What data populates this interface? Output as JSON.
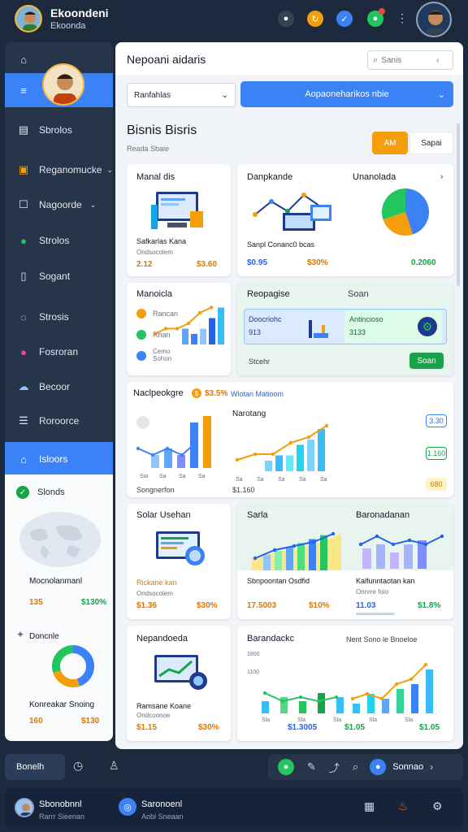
{
  "app": {
    "title": "Ekoondeni",
    "subtitle": "Ekoonda"
  },
  "colors": {
    "bg": "#1d2a3d",
    "accent": "#3b82f6",
    "orange": "#f59e0b",
    "green": "#16a34a"
  },
  "sidebar": {
    "items": [
      {
        "label": "",
        "icon": "home-icon"
      },
      {
        "label": "",
        "icon": "menu-icon"
      },
      {
        "label": "Sbrolos",
        "icon": "document-icon"
      },
      {
        "label": "Reganomucke",
        "icon": "folder-icon"
      },
      {
        "label": "Nagoorde",
        "icon": "square-icon"
      },
      {
        "label": "Strolos",
        "icon": "apple-icon"
      },
      {
        "label": "Sogant",
        "icon": "book-icon"
      },
      {
        "label": "Strosis",
        "icon": "location-icon"
      },
      {
        "label": "Fosroran",
        "icon": "pin-icon"
      },
      {
        "label": "Becoor",
        "icon": "cloud-icon"
      },
      {
        "label": "Roroorce",
        "icon": "list-icon"
      },
      {
        "label": "Isloors",
        "icon": "house-icon"
      }
    ],
    "lower": {
      "section_label": "Slonds",
      "map_caption": "Mocnolanmanl",
      "map_value": "135",
      "map_change": "$130%",
      "donut_title": "Doncnle",
      "donut_caption": "Konreakar Snoing",
      "donut_value": "160",
      "donut_change": "$130"
    }
  },
  "header": {
    "title": "Nepoani aidaris",
    "search_placeholder": "Sanis",
    "dropdown_value": "Ranfahlas",
    "primary_button": "Aopaoneharikos nbie"
  },
  "section": {
    "title": "Bisnis Bisris",
    "subtitle": "Reada Sbaie",
    "btn_primary": "AM",
    "btn_secondary": "Sapai"
  },
  "cards": {
    "c1": {
      "title": "Manal dis",
      "caption": "Safkarlas Kana",
      "subcaption": "Ondsocolem",
      "value": "2.12",
      "change": "$3.60"
    },
    "c2": {
      "title": "Danpkande",
      "title2": "Unanolada",
      "caption": "Sanpl Conanc0 bcas",
      "value": "$0.95",
      "change": "$30%",
      "value2": "0.2060"
    },
    "c3": {
      "title": "Manoicla",
      "rows": [
        "Rancan",
        "Rhan",
        "Cemo Sohon"
      ]
    },
    "c4": {
      "title": "Reopagise",
      "title2": "Soan",
      "inner_left": "Doocriohc",
      "inner_left_val": "913",
      "inner_right": "Antincioso",
      "inner_right_val": "3133",
      "footer": "Stcehr",
      "button": "Soan"
    },
    "c5": {
      "title": "Naclpeokgre",
      "badge": "$3.5%",
      "badge_text": "Wlotan Matioom",
      "mid_title": "Narotang",
      "caption": "Songnerfon",
      "value": "$1.160",
      "tag1": "3.30",
      "tag2": "1.160",
      "tag3": "680",
      "xlabels": [
        "Sia",
        "Sa",
        "Sa",
        "Sa"
      ],
      "xlabels2": [
        "Sa",
        "Sa",
        "Sa",
        "Sa",
        "Sa"
      ]
    },
    "c6": {
      "title": "Solar Usehan",
      "caption": "Rickane kan",
      "subcaption": "Ondsocolem",
      "value": "$1.36",
      "change": "$30%"
    },
    "c7": {
      "title": "Sarla",
      "title2": "Baronadanan",
      "caption": "Sbnpoontan Osdfid",
      "value": "17.5003",
      "change": "$10%",
      "caption2": "Kalfunntaotan kan",
      "subcaption2": "Onnrre foio",
      "value2": "11.03",
      "change2": "$1.8%"
    },
    "c8": {
      "title": "Nepandoeda",
      "caption": "Ramsane Koane",
      "subcaption": "Ondcoonoe",
      "value": "$1.15",
      "change": "$30%"
    },
    "c9": {
      "title": "Barandackc",
      "legend": "Nent Sono le Bnoeloe",
      "yt": "1800",
      "yb": "1100",
      "xlabels": [
        "Sla",
        "Sla",
        "Sla",
        "Sla",
        "Sla"
      ],
      "value": "$1.3005",
      "value2": "$1.05",
      "change": "$1.05"
    }
  },
  "bottom": {
    "left_label": "Bonelh",
    "right_label": "Sonnao",
    "user_name": "Sbonobnnl",
    "user_sub": "Rarrr Sieenan",
    "brand": "Saronoenl",
    "brand_sub": "Aobl Sneaan"
  },
  "chart_data": [
    {
      "type": "bar",
      "values": [
        3,
        2,
        3,
        5,
        7
      ],
      "series": [
        {
          "name": "",
          "values": [
            3,
            2,
            3,
            5,
            7
          ]
        }
      ]
    },
    {
      "type": "bar",
      "categories": [
        "Sia",
        "Sa",
        "Sa",
        "Sa"
      ],
      "values": [
        2,
        3,
        2,
        7,
        8
      ],
      "series": [
        {
          "name": "",
          "values": [
            2,
            3,
            2,
            7,
            8
          ]
        }
      ]
    },
    {
      "type": "line",
      "categories": [
        "Sa",
        "Sa",
        "Sa",
        "Sa",
        "Sa"
      ],
      "series": [
        {
          "name": "",
          "values": [
            2,
            3,
            3,
            5,
            6,
            8
          ]
        }
      ]
    },
    {
      "type": "bar",
      "values": [
        4,
        5,
        6,
        7,
        8,
        9
      ],
      "series": [
        {
          "name": "",
          "values": [
            4,
            5,
            6,
            7,
            8,
            9
          ]
        }
      ]
    },
    {
      "type": "bar",
      "values": [
        5,
        6,
        4,
        6,
        7
      ],
      "series": [
        {
          "name": "",
          "values": [
            5,
            6,
            4,
            6,
            7
          ]
        }
      ]
    },
    {
      "type": "pie",
      "values": [
        45,
        25,
        30
      ],
      "categories": [
        "blue",
        "orange",
        "green"
      ]
    }
  ]
}
